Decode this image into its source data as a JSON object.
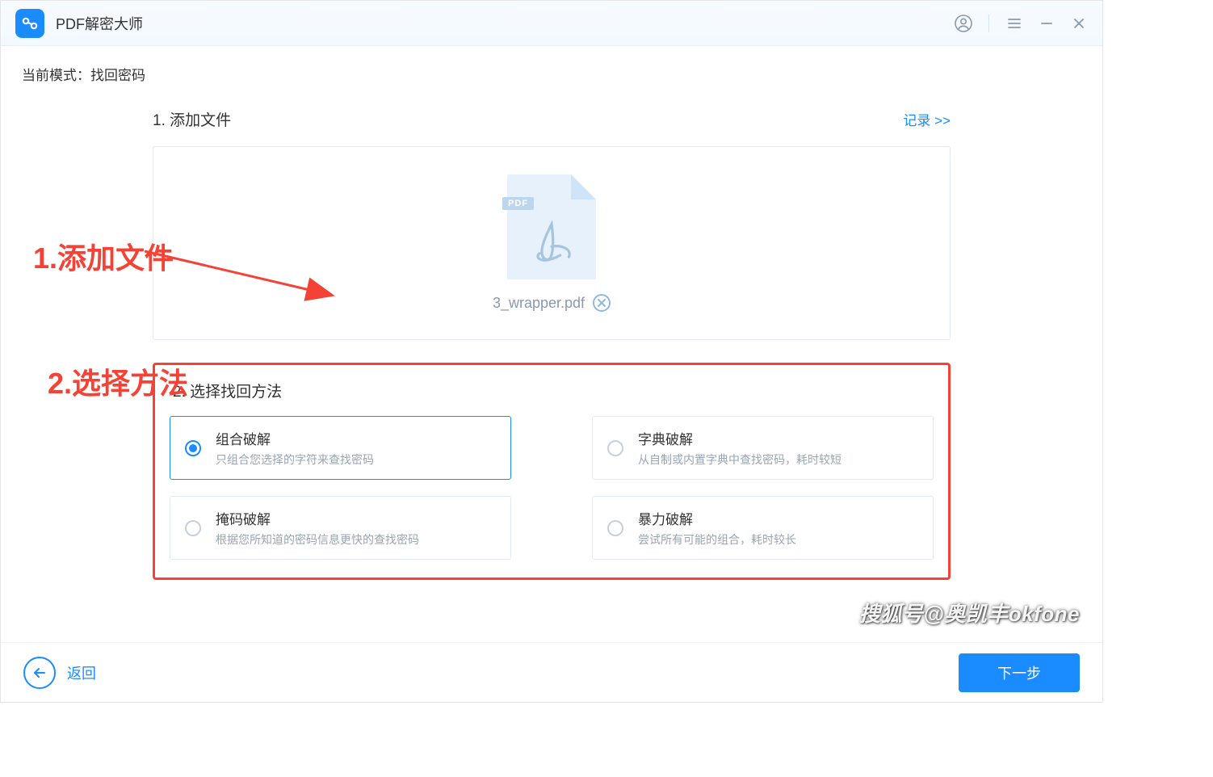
{
  "header": {
    "app_title": "PDF解密大师"
  },
  "mode": {
    "label": "当前模式：找回密码"
  },
  "step1": {
    "title": "1. 添加文件",
    "record_link": "记录 >>",
    "badge": "PDF",
    "filename": "3_wrapper.pdf"
  },
  "step2": {
    "title": "2. 选择找回方法",
    "options": [
      {
        "title": "组合破解",
        "desc": "只组合您选择的字符来查找密码",
        "selected": true
      },
      {
        "title": "字典破解",
        "desc": "从自制或内置字典中查找密码，耗时较短",
        "selected": false
      },
      {
        "title": "掩码破解",
        "desc": "根据您所知道的密码信息更快的查找密码",
        "selected": false
      },
      {
        "title": "暴力破解",
        "desc": "尝试所有可能的组合，耗时较长",
        "selected": false
      }
    ]
  },
  "footer": {
    "back": "返回",
    "next": "下一步"
  },
  "annotations": {
    "a1": "1.添加文件",
    "a2": "2.选择方法"
  },
  "watermark": "搜狐号@奥凯丰okfone"
}
